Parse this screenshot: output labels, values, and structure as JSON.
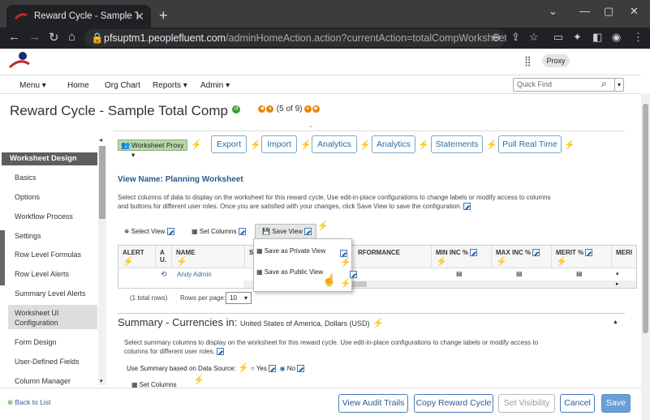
{
  "browser": {
    "tab_title": "Reward Cycle - Sample Total Com",
    "url_host": "pfsuptm1.peoplefluent.com",
    "url_path": "/adminHomeAction.action?currentAction=totalCompWorksheetRunList..."
  },
  "header": {
    "proxy_label": "Proxy"
  },
  "menubar": {
    "items": [
      "Menu ▾",
      "Home",
      "Org Chart",
      "Reports ▾",
      "Admin ▾"
    ],
    "quick_find_placeholder": "Quick Find"
  },
  "page": {
    "title": "Reward Cycle - Sample Total Comp",
    "pager": "(5 of 9)"
  },
  "sidebar": {
    "header": "Worksheet Design",
    "items": [
      "Basics",
      "Options",
      "Workflow Process",
      "Settings",
      "Row Level Formulas",
      "Row Level Alerts",
      "Summary Level Alerts",
      "Worksheet UI Configuration",
      "Form Design",
      "User-Defined Fields",
      "Column Manager"
    ]
  },
  "toolbar": {
    "proxy_button": "Worksheet Proxy",
    "buttons": [
      "Export",
      "Import",
      "Analytics",
      "Analytics",
      "Statements",
      "Pull Real Time"
    ]
  },
  "view": {
    "name": "View Name: Planning Worksheet",
    "description": "Select columns of data to display on the worksheet for this reward cycle. Use edit-in-place configurations to change labels or modify access to columns and buttons for different user roles. Once you are satisfied with your changes, click Save View to save the configuration.",
    "select_view": "Select View",
    "set_columns": "Set Columns",
    "save_view": "Save View",
    "save_private": "Save as Private View",
    "save_public": "Save as Public View"
  },
  "grid": {
    "headers": [
      "ALERT",
      "A U.",
      "NAME",
      "S",
      "RFORMANCE",
      "MIN INC %",
      "MAX INC %",
      "MERIT %",
      "MERI"
    ],
    "row_name": "Andy Admin",
    "total_rows": "(1 total rows)",
    "rows_per_page_label": "Rows per page:",
    "rows_per_page": "10"
  },
  "summary": {
    "title": "Summary - Currencies in:",
    "currency": "United States of America, Dollars (USD)",
    "description": "Select summary columns to display on the worksheet for this reward cycle. Use edit-in-place configurations to change labels or modify access to columns for different user roles.",
    "use_summary_label": "Use Summary based on Data Source:",
    "yes": "Yes",
    "no": "No",
    "set_columns": "Set Columns"
  },
  "footer": {
    "back": "Back to List",
    "buttons": [
      "View Audit Trails",
      "Copy Reward Cycle",
      "Set Visibility",
      "Cancel",
      "Save"
    ]
  },
  "colors": {
    "accent": "#2a6ea8",
    "bolt": "#f0b400",
    "save_bg": "#6a9fd8"
  }
}
